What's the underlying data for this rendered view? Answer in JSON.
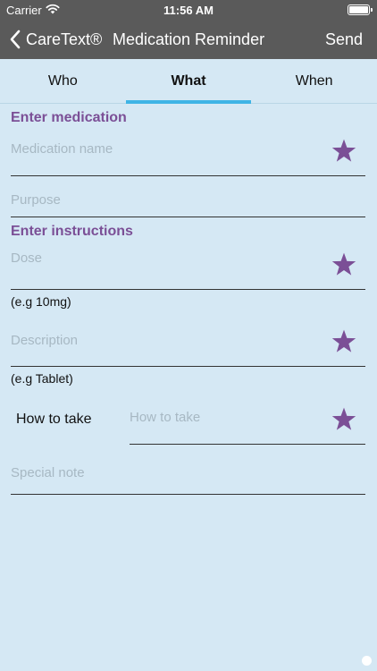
{
  "status_bar": {
    "carrier": "Carrier",
    "time": "11:56 AM"
  },
  "nav": {
    "back_label": "CareText®",
    "title": "Medication Reminder",
    "send_label": "Send"
  },
  "tabs": [
    {
      "label": "Who"
    },
    {
      "label": "What",
      "active": true
    },
    {
      "label": "When"
    }
  ],
  "medication_section": {
    "title": "Enter medication",
    "name_placeholder": "Medication name",
    "purpose_placeholder": "Purpose"
  },
  "instructions_section": {
    "title": "Enter instructions",
    "dose_placeholder": "Dose",
    "dose_hint": "(e.g 10mg)",
    "description_placeholder": "Description",
    "description_hint": "(e.g Tablet)",
    "how_to_take_label": "How to take",
    "how_to_take_placeholder": "How to take",
    "special_note_placeholder": "Special note"
  },
  "colors": {
    "accent": "#7b4f96",
    "tab_indicator": "#3fb4e5",
    "background": "#d5e8f4",
    "nav_bar": "#5a5a5a"
  }
}
